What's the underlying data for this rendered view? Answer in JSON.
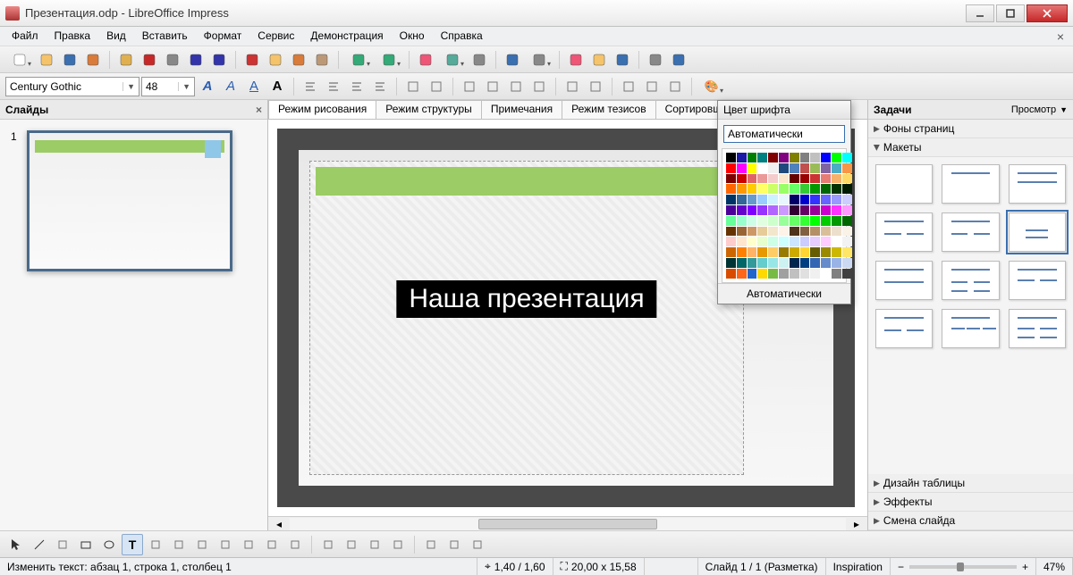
{
  "window": {
    "title": "Презентация.odp - LibreOffice Impress"
  },
  "menu": [
    "Файл",
    "Правка",
    "Вид",
    "Вставить",
    "Формат",
    "Сервис",
    "Демонстрация",
    "Окно",
    "Справка"
  ],
  "font": {
    "name": "Century Gothic",
    "size": "48"
  },
  "panels": {
    "slides": {
      "title": "Слайды",
      "thumb_num": "1"
    },
    "tasks": {
      "title": "Задачи",
      "view_label": "Просмотр",
      "sections": {
        "pages": "Фоны страниц",
        "layouts": "Макеты",
        "table": "Дизайн таблицы",
        "effects": "Эффекты",
        "transition": "Смена слайда"
      }
    }
  },
  "viewtabs": [
    "Режим рисования",
    "Режим структуры",
    "Примечания",
    "Режим тезисов",
    "Сортировщик слайдов"
  ],
  "slide": {
    "title_text": "Наша презентация"
  },
  "colorpicker": {
    "title": "Цвет шрифта",
    "auto": "Автоматически",
    "footer": "Автоматически"
  },
  "status": {
    "edit": "Изменить текст: абзац 1, строка 1, столбец 1",
    "pos": "1,40 / 1,60",
    "size": "20,00 x 15,58",
    "slide": "Слайд 1 / 1 (Разметка)",
    "template": "Inspiration",
    "zoom": "47%"
  },
  "toolbar_icons": [
    "new-doc",
    "open",
    "save",
    "mail",
    "divider",
    "edit",
    "pdf",
    "print",
    "rec1",
    "rec2",
    "divider",
    "cut",
    "copy",
    "paste",
    "brush",
    "divider",
    "undo",
    "redo",
    "divider",
    "chart",
    "table",
    "link",
    "divider",
    "navigator",
    "zoom",
    "divider",
    "help",
    "gallery",
    "presentation",
    "divider",
    "grid",
    "show"
  ],
  "format_icons": [
    "bold-A",
    "italic-A",
    "underline-A",
    "color-A",
    "divider",
    "align-left",
    "align-center",
    "align-right",
    "align-just",
    "divider",
    "list1",
    "list2",
    "divider",
    "indent-left",
    "indent-right",
    "move-up",
    "move-down",
    "divider",
    "sub",
    "super",
    "divider",
    "char",
    "para",
    "list-opts",
    "divider",
    "font-color"
  ],
  "draw_icons": [
    "pointer",
    "line",
    "line-end",
    "rect",
    "ellipse",
    "text",
    "pencil",
    "connector",
    "diamond",
    "smiley",
    "arrow",
    "star",
    "callout",
    "divider",
    "points",
    "glue",
    "fontwork",
    "image",
    "divider",
    "rotate",
    "align",
    "arrange"
  ]
}
